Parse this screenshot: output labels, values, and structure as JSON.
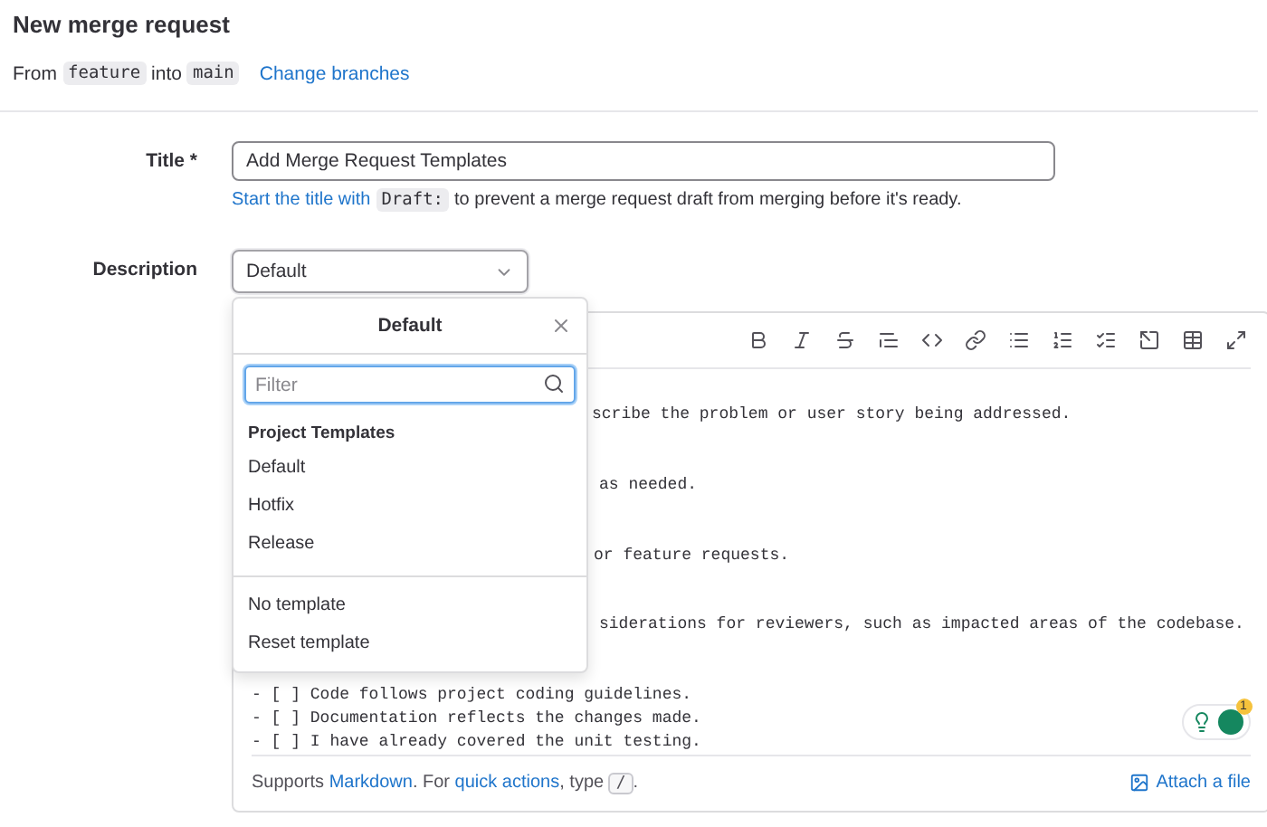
{
  "page_title": "New merge request",
  "branch_info": {
    "prefix": "From",
    "source": "feature",
    "joiner": "into",
    "target": "main",
    "link": "Change branches"
  },
  "title_field": {
    "label": "Title *",
    "value": "Add Merge Request Templates",
    "hint_link": "Start the title with",
    "hint_code": "Draft:",
    "hint_rest": "to prevent a merge request draft from merging before it's ready."
  },
  "description": {
    "label": "Description",
    "template_select": {
      "value": "Default",
      "expanded": true
    },
    "dropdown": {
      "title": "Default",
      "filter_placeholder": "Filter",
      "section": "Project Templates",
      "templates": [
        "Default",
        "Hotfix",
        "Release"
      ],
      "actions": [
        "No template",
        "Reset template"
      ]
    }
  },
  "editor": {
    "lines": [
      {
        "kind": "partial",
        "text": "scribe the problem or user story being addressed."
      },
      {
        "kind": "partial",
        "text": "as needed."
      },
      {
        "kind": "partial",
        "text": "or feature requests."
      },
      {
        "kind": "partial",
        "text": "siderations for reviewers, such as impacted areas of the codebase."
      },
      {
        "kind": "full",
        "text": "- [ ] Code follows project coding guidelines."
      },
      {
        "kind": "full",
        "text": "- [ ] Documentation reflects the changes made."
      },
      {
        "kind": "full",
        "text": "- [ ] I have already covered the unit testing."
      }
    ],
    "grammarly_count": "1",
    "footer": {
      "prefix": "Supports",
      "markdown_link": "Markdown",
      "middle": ". For",
      "quick_link": "quick actions",
      "after": ", type",
      "key": "/",
      "end": ".",
      "attach": "Attach a file"
    }
  }
}
